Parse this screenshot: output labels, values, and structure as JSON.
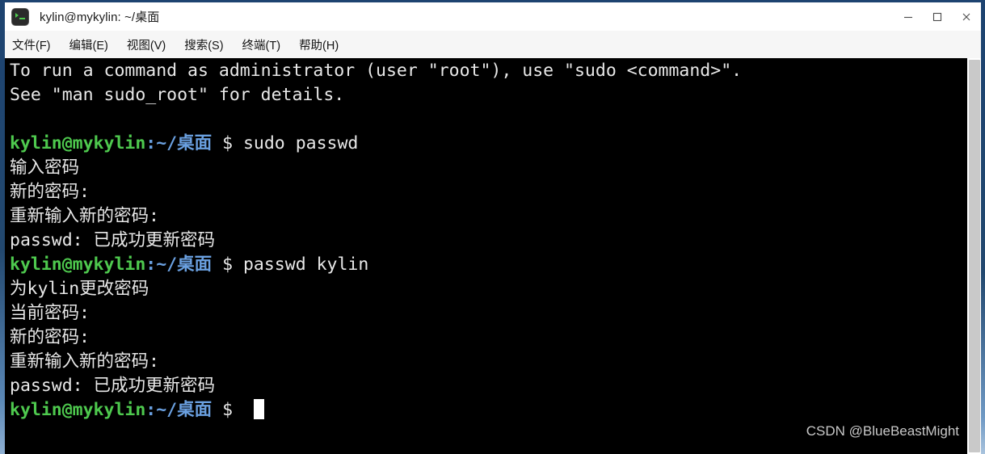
{
  "window": {
    "title": "kylin@mykylin: ~/桌面",
    "icon": "terminal-icon",
    "border_color": "#1d4370",
    "controls": [
      {
        "name": "minimize",
        "glyph": "—"
      },
      {
        "name": "maximize",
        "glyph": "□"
      },
      {
        "name": "close",
        "glyph": "✕"
      }
    ]
  },
  "menubar": {
    "items": [
      {
        "label": "文件(F)"
      },
      {
        "label": "编辑(E)"
      },
      {
        "label": "视图(V)"
      },
      {
        "label": "搜索(S)"
      },
      {
        "label": "终端(T)"
      },
      {
        "label": "帮助(H)"
      }
    ]
  },
  "terminal": {
    "background": "#000000",
    "foreground": "#e8e8e8",
    "prompt_user_color": "#4ec94e",
    "prompt_path_color": "#6aa0e0",
    "prompt_user": "kylin@mykylin",
    "prompt_sep": ":",
    "prompt_path": "~/桌面",
    "prompt_symbol": "$",
    "lines": [
      {
        "type": "output",
        "text": "To run a command as administrator (user \"root\"), use \"sudo <command>\"."
      },
      {
        "type": "output",
        "text": "See \"man sudo_root\" for details."
      },
      {
        "type": "output",
        "text": ""
      },
      {
        "type": "prompt",
        "command": "sudo passwd"
      },
      {
        "type": "output",
        "text": "输入密码"
      },
      {
        "type": "output",
        "text": "新的密码:"
      },
      {
        "type": "output",
        "text": "重新输入新的密码:"
      },
      {
        "type": "output",
        "text": "passwd: 已成功更新密码"
      },
      {
        "type": "prompt",
        "command": "passwd kylin"
      },
      {
        "type": "output",
        "text": "为kylin更改密码"
      },
      {
        "type": "output",
        "text": "当前密码:"
      },
      {
        "type": "output",
        "text": "新的密码:"
      },
      {
        "type": "output",
        "text": "重新输入新的密码:"
      },
      {
        "type": "output",
        "text": "passwd: 已成功更新密码"
      },
      {
        "type": "prompt",
        "command": "",
        "cursor": true
      }
    ]
  },
  "watermark": {
    "text": "CSDN @BlueBeastMight"
  }
}
